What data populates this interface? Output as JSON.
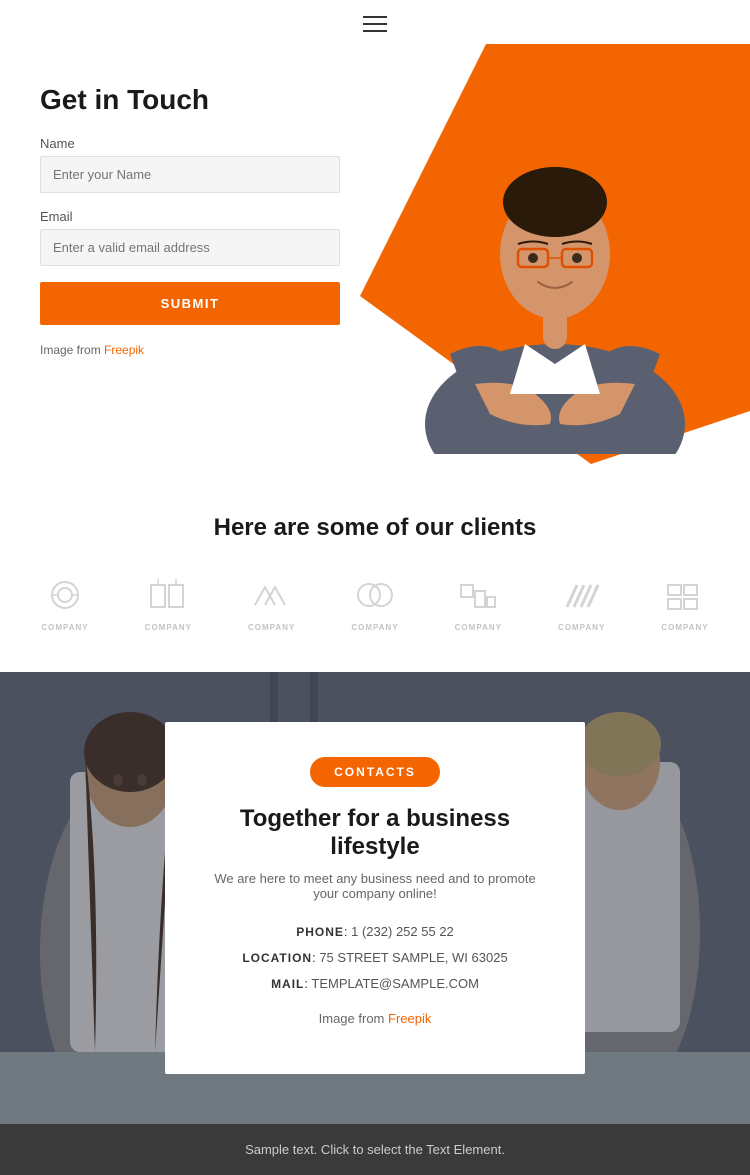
{
  "header": {
    "menu_icon_label": "menu"
  },
  "hero": {
    "title": "Get in Touch",
    "name_label": "Name",
    "name_placeholder": "Enter your Name",
    "email_label": "Email",
    "email_placeholder": "Enter a valid email address",
    "submit_label": "SUBMIT",
    "image_credit_prefix": "Image from ",
    "image_credit_link": "Freepik"
  },
  "clients": {
    "heading": "Here are some of our clients",
    "logos": [
      {
        "id": "logo1",
        "text": "COMPANY"
      },
      {
        "id": "logo2",
        "text": "COMPANY"
      },
      {
        "id": "logo3",
        "text": "COMPANY"
      },
      {
        "id": "logo4",
        "text": "COMPANY"
      },
      {
        "id": "logo5",
        "text": "COMPANY"
      },
      {
        "id": "logo6",
        "text": "COMPANY"
      },
      {
        "id": "logo7",
        "text": "COMPANY"
      }
    ]
  },
  "contacts": {
    "badge": "CONTACTS",
    "heading": "Together for a business lifestyle",
    "subtext": "We are here to meet any business need and to promote your company online!",
    "phone_label": "PHONE",
    "phone_value": "1 (232) 252 55 22",
    "location_label": "LOCATION",
    "location_value": "75 STREET SAMPLE, WI 63025",
    "mail_label": "MAIL",
    "mail_value": "TEMPLATE@SAMPLE.COM",
    "image_credit_prefix": "Image from ",
    "image_credit_link": "Freepik"
  },
  "footer": {
    "text": "Sample text. Click to select the Text Element."
  }
}
